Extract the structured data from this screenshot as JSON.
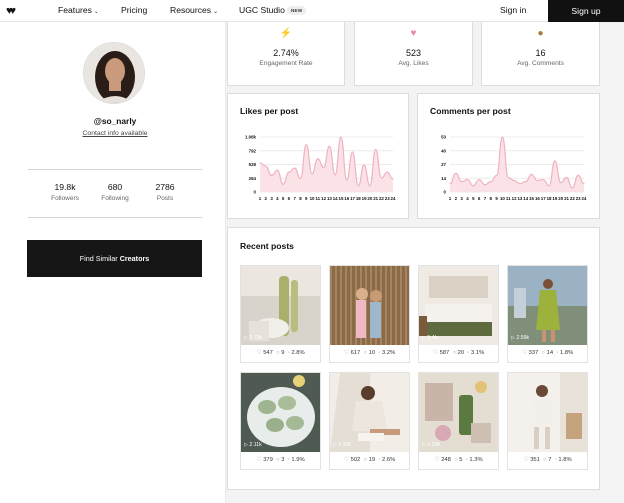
{
  "nav": {
    "logo": "♥♥",
    "features": "Features",
    "pricing": "Pricing",
    "resources": "Resources",
    "ugc": "UGC Studio",
    "new_badge": "NEW",
    "sign_in": "Sign in",
    "sign_up": "Sign up",
    "chevron": "⌄"
  },
  "profile": {
    "handle": "@so_narly",
    "contact": "Contact info available",
    "followers_value": "19.8k",
    "followers_label": "Followers",
    "following_value": "680",
    "following_label": "Following",
    "posts_value": "2786",
    "posts_label": "Posts",
    "find_prefix": "Find Similar",
    "find_bold": "Creators"
  },
  "metrics": {
    "engagement": {
      "value": "2.74%",
      "label": "Engagement Rate",
      "icon": "⚡",
      "icon_name": "lightning-icon",
      "color": "#2f9c5f"
    },
    "likes": {
      "value": "523",
      "label": "Avg. Likes",
      "icon": "♥",
      "icon_name": "heart-icon",
      "color": "#e48aa6"
    },
    "comments": {
      "value": "16",
      "label": "Avg. Comments",
      "icon": "●",
      "icon_name": "comment-bubble-icon",
      "color": "#a97a3c"
    }
  },
  "likes_chart": {
    "title": "Likes per post",
    "chart_data": {
      "type": "area",
      "x": [
        1,
        2,
        3,
        4,
        5,
        6,
        7,
        8,
        9,
        10,
        11,
        12,
        13,
        14,
        15,
        16,
        17,
        18,
        19,
        20,
        21,
        22,
        23,
        24
      ],
      "values": [
        560,
        500,
        320,
        420,
        150,
        380,
        460,
        260,
        910,
        350,
        640,
        470,
        880,
        330,
        1060,
        230,
        770,
        120,
        520,
        120,
        820,
        270,
        380,
        250
      ],
      "ytick_labels": [
        "0",
        "264",
        "528",
        "792",
        "1.06k"
      ],
      "ylim": [
        0,
        1060
      ],
      "color": "#f3c6cf"
    }
  },
  "comments_chart": {
    "title": "Comments per post",
    "chart_data": {
      "type": "area",
      "x": [
        1,
        2,
        3,
        4,
        5,
        6,
        7,
        8,
        9,
        10,
        11,
        12,
        13,
        14,
        15,
        16,
        17,
        18,
        19,
        20,
        21,
        22,
        23,
        24
      ],
      "values": [
        8,
        18,
        10,
        12,
        6,
        12,
        7,
        10,
        16,
        53,
        14,
        11,
        8,
        10,
        17,
        11,
        12,
        6,
        30,
        9,
        14,
        4,
        16,
        8
      ],
      "ytick_labels": [
        "0",
        "14",
        "27",
        "40",
        "53"
      ],
      "ylim": [
        0,
        53
      ],
      "color": "#f3c6cf"
    }
  },
  "recent": {
    "title": "Recent posts",
    "posts": [
      {
        "views": "▷ 3.79k",
        "likes": "547",
        "comments": "9",
        "rate": "2.8%"
      },
      {
        "views": "",
        "likes": "617",
        "comments": "10",
        "rate": "3.2%"
      },
      {
        "views": "▷ 5.4k",
        "likes": "587",
        "comments": "20",
        "rate": "3.1%"
      },
      {
        "views": "▷ 2.59k",
        "likes": "337",
        "comments": "14",
        "rate": "1.8%"
      },
      {
        "views": "▷ 2.11k",
        "likes": "379",
        "comments": "3",
        "rate": "1.9%"
      },
      {
        "views": "▷ 5.32k",
        "likes": "502",
        "comments": "19",
        "rate": "2.6%"
      },
      {
        "views": "▷ 2.29k",
        "likes": "248",
        "comments": "5",
        "rate": "1.3%"
      },
      {
        "views": "",
        "likes": "351",
        "comments": "7",
        "rate": "1.8%"
      }
    ]
  }
}
